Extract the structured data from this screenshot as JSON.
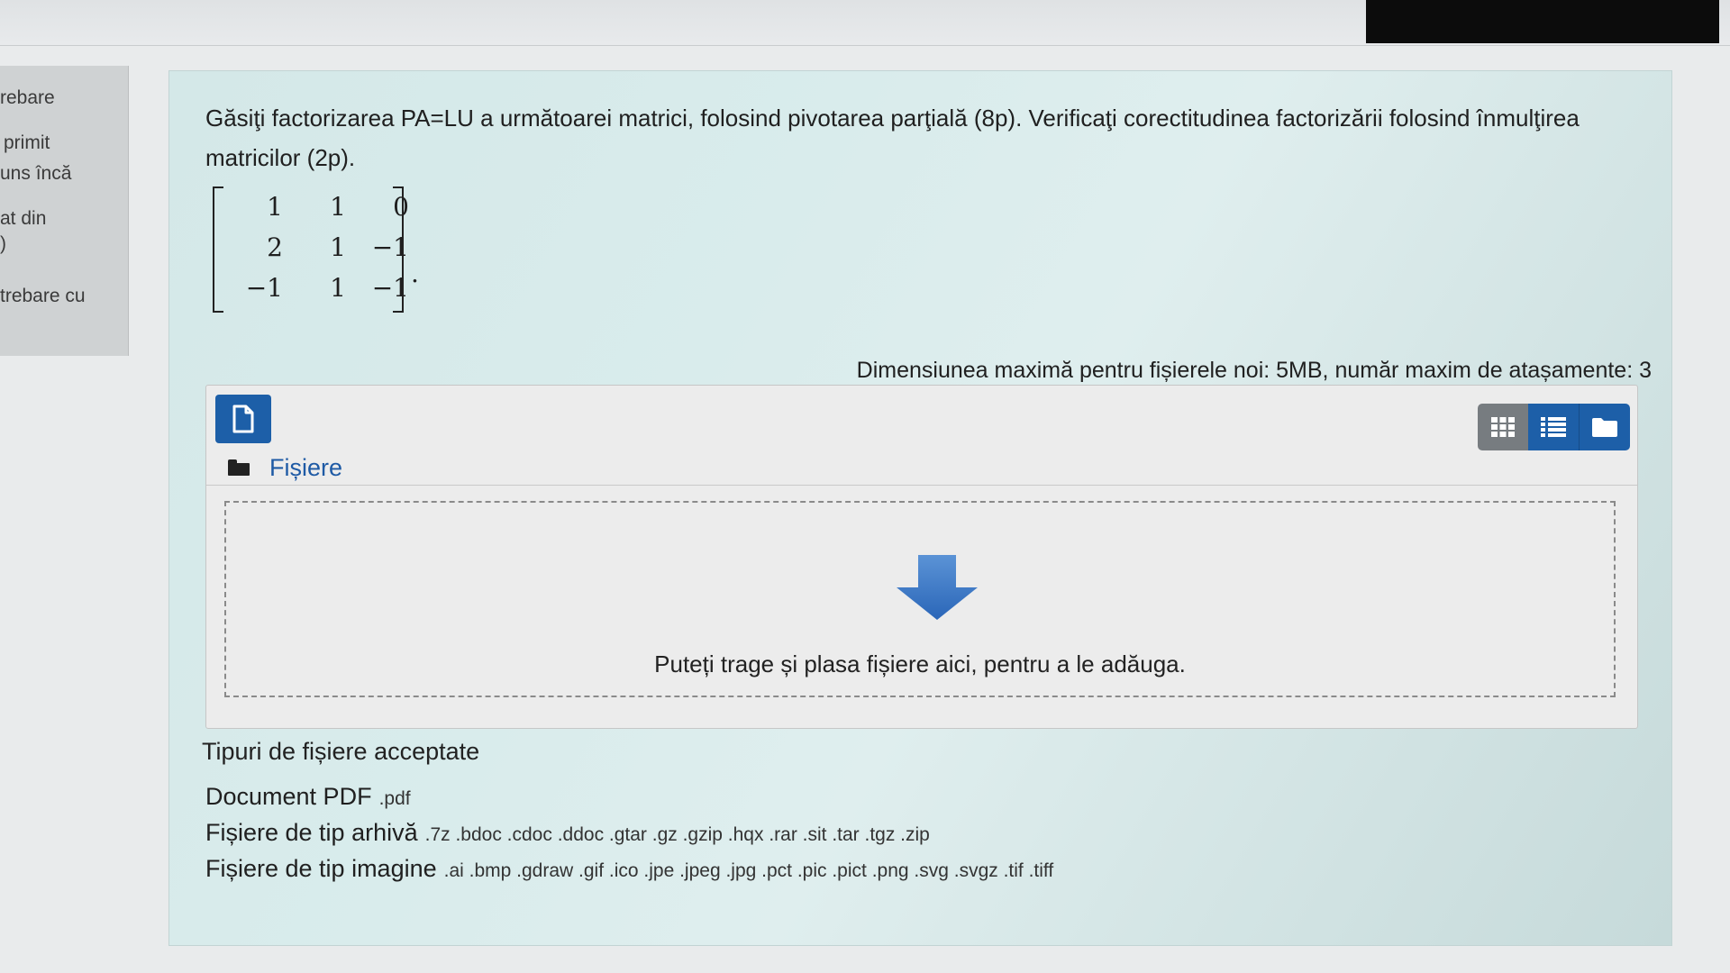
{
  "sidebar": {
    "items": [
      "rebare",
      "primit",
      "uns încă",
      "at din",
      ")",
      "trebare cu"
    ]
  },
  "question": {
    "text": "Găsiţi factorizarea PA=LU a următoarei matrici, folosind pivotarea parţială (8p). Verificaţi corectitudinea factorizării folosind înmulţirea matricilor (2p).",
    "matrix": [
      [
        "1",
        "1",
        "0"
      ],
      [
        "2",
        "1",
        "−1"
      ],
      [
        "−1",
        "1",
        "−1"
      ]
    ],
    "matrix_suffix": "."
  },
  "filemanager": {
    "max_size_text": "Dimensiunea maximă pentru fișierele noi: 5MB, număr maxim de atașamente: 3",
    "folder_label": "Fișiere",
    "drop_text": "Puteți trage și plasa fișiere aici, pentru a le adăuga.",
    "icons": {
      "add": "file-icon",
      "grid": "grid-view-icon",
      "list": "list-view-icon",
      "tree": "folder-view-icon",
      "drop": "down-arrow-icon"
    }
  },
  "accepted": {
    "title": "Tipuri de fișiere acceptate",
    "types": [
      {
        "name": "Document PDF",
        "ext": ".pdf"
      },
      {
        "name": "Fișiere de tip arhivă",
        "ext": ".7z .bdoc .cdoc .ddoc .gtar .gz .gzip .hqx .rar .sit .tar .tgz .zip"
      },
      {
        "name": "Fișiere de tip imagine",
        "ext": ".ai .bmp .gdraw .gif .ico .jpe .jpeg .jpg .pct .pic .pict .png .svg .svgz .tif .tiff"
      }
    ]
  },
  "colors": {
    "primary": "#1d5fa8",
    "question_bg": "#d4e8e8",
    "link": "#1e5aa5"
  }
}
